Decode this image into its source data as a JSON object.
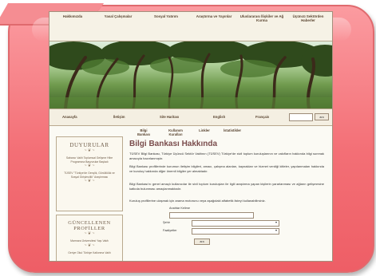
{
  "top_nav": [
    "Hakkımızda",
    "Yasal Çalışmalar",
    "Sosyal Yatırım",
    "Araştırma ve Yayınlar",
    "Uluslararası İlişkiler ve Ağ Kurma",
    "Üçüncü Sektörden Haberler"
  ],
  "sub_nav": [
    "Anasayfa",
    "İletişim",
    "Site Haritası",
    "English",
    "Français"
  ],
  "search": {
    "button_label": "ara"
  },
  "section_nav": [
    "Bilgi Bankası",
    "Kullanım Kuralları",
    "Linkler",
    "İstatistikler"
  ],
  "sidebar": {
    "duyurular_title": "DUYURULAR",
    "duyurular_items": [
      "Sabancı Vakfı Toplumsal Gelişme Hibe Programına Başvurular Başladı",
      "TÜSEV \"Türkiye'de Gençlik, Gönüllülük ve Sosyal Girişimcilik\" Araştırması"
    ],
    "profiller_title": "GÜNCELLENEN PROFİLLER",
    "profiller_items": [
      "Marmara Üniversitesi Yaşı Vakfı",
      "Geriye Okul Türkiye Kalkınma Vakfı"
    ]
  },
  "main": {
    "title": "Bilgi Bankası Hakkında",
    "paragraphs": [
      "TÜSEV Bilgi Bankası, Türkiye Üçüncü Sektör Vakfının (TÜSEV) Türkiye'de sivil toplum kuruluşlarının ve vakıfların hakkında bilgi sunmak amacıyla hazırlanmıştır.",
      "Bilgi Bankası profillerinde kurumun iletişim bilgileri, amacı, çalışma alanları, kaynakları ve hizmet verdiği kitleler, yapılanmaları hakkında ve kuruluş hakkında diğer önemli bilgiler yer almaktadır.",
      "Bilgi Bankası'nı genel amaçlı kullanıcılar ile sivil toplum kuruluşları ile ilgili araştırma yapan kişilerin yararlanması ve ağların gelişmesine katkıda bulunması amaçlanmaktadır."
    ],
    "search_intro": "Kuruluş profillerine ulaşmak için arama motorunu veya aşağıdaki alfabetik listeyi kullanabilirsiniz.",
    "form": {
      "keyword_label": "Anahtar Kelime",
      "city_label": "Şehir",
      "field_label": "Faaliyetler",
      "submit_label": "ara"
    }
  },
  "colors": {
    "callout_fill": "#f4767c",
    "callout_border": "#e06a6e",
    "title_color": "#7a4c4c",
    "nav_text": "#5b4632"
  }
}
